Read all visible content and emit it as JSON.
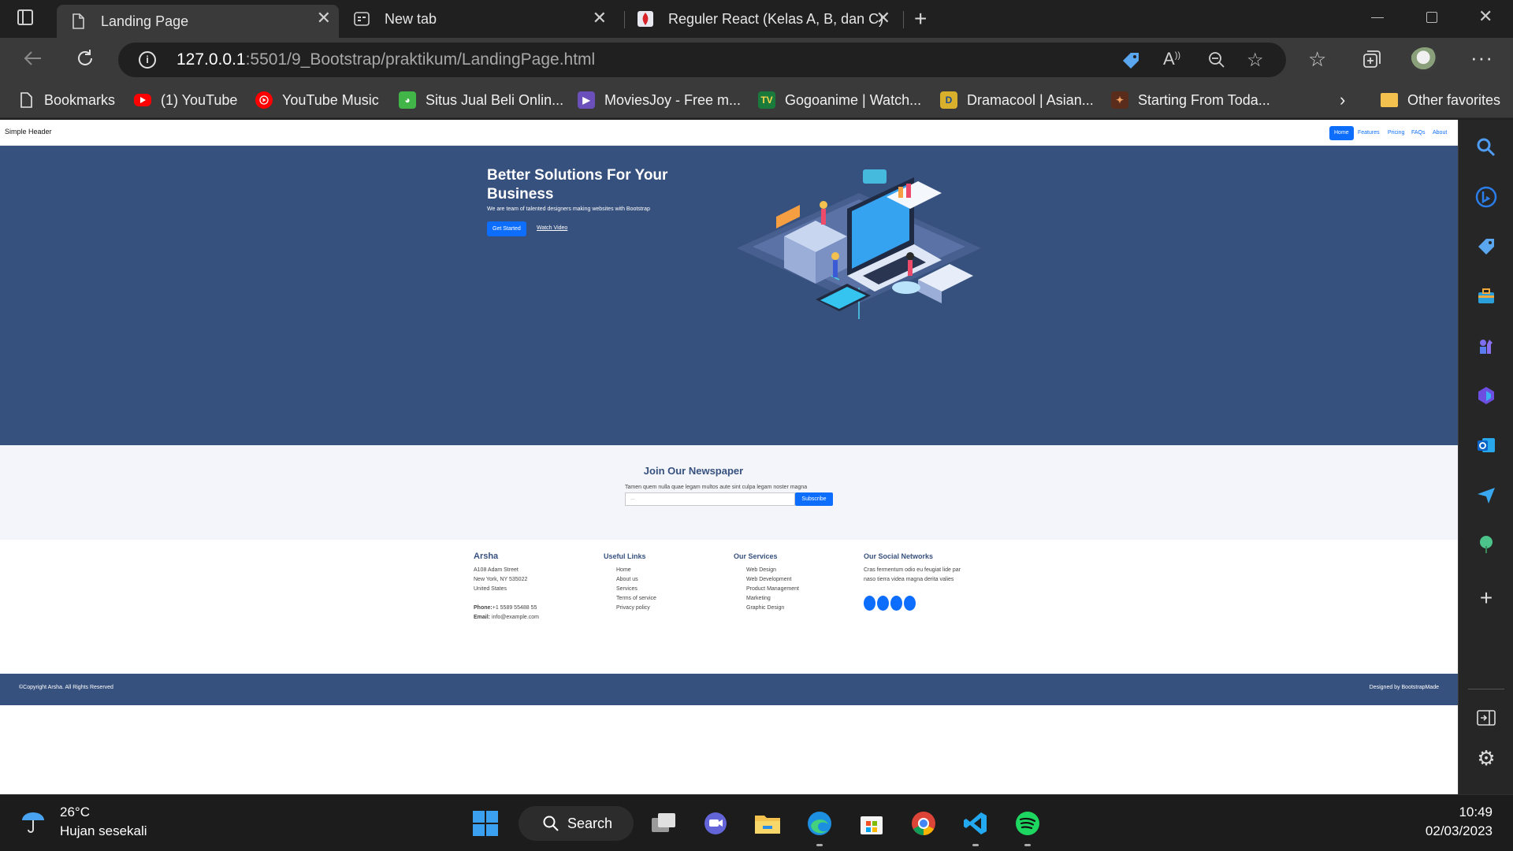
{
  "browser": {
    "tabs": [
      {
        "title": "Landing Page"
      },
      {
        "title": "New tab"
      },
      {
        "title": "Reguler React (Kelas A, B, dan C)"
      }
    ],
    "url_host": "127.0.0.1",
    "url_rest": ":5501/9_Bootstrap/praktikum/LandingPage.html",
    "favorites": [
      {
        "label": "Bookmarks",
        "icon": "page-icon"
      },
      {
        "label": "(1) YouTube",
        "icon": "youtube-icon"
      },
      {
        "label": "YouTube Music",
        "icon": "youtube-music-icon"
      },
      {
        "label": "Situs Jual Beli Onlin...",
        "icon": "tokopedia-icon"
      },
      {
        "label": "MoviesJoy - Free m...",
        "icon": "moviesjoy-icon"
      },
      {
        "label": "Gogoanime | Watch...",
        "icon": "gogoanime-icon"
      },
      {
        "label": "Dramacool | Asian...",
        "icon": "dramacool-icon"
      },
      {
        "label": "Starting From Toda...",
        "icon": "starting-icon"
      }
    ],
    "other_favorites": "Other favorites"
  },
  "page": {
    "brand": "Simple Header",
    "nav": [
      "Home",
      "Features",
      "Pricing",
      "FAQs",
      "About"
    ],
    "hero": {
      "title": "Better Solutions For Your Business",
      "subtitle": "We are team of talented designers making websites with Bootstrap",
      "primary": "Get Started",
      "secondary": "Watch Video"
    },
    "newsletter": {
      "title": "Join Our Newspaper",
      "desc": "Tamen quem nulla quae legam multos aute sint culpa legam noster magna",
      "placeholder": "...",
      "button": "Subscribe"
    },
    "footer": {
      "company": "Arsha",
      "address1": "A108 Adam Street",
      "address2": "New York, NY 535022",
      "address3": "United States",
      "phone_label": "Phone:",
      "phone": "+1 5589 55488 55",
      "email_label": "Email:",
      "email": "info@example.com",
      "useful_title": "Useful Links",
      "useful": [
        "Home",
        "About us",
        "Services",
        "Terms of service",
        "Privacy policy"
      ],
      "services_title": "Our Services",
      "services": [
        "Web Design",
        "Web Development",
        "Product Management",
        "Marketing",
        "Graphic Design"
      ],
      "social_title": "Our Social Networks",
      "social_desc1": "Cras fermentum odio eu feugiat lide par",
      "social_desc2": "naso tierra videa magna derita valies"
    },
    "copyright": "©Copyright Arsha. All Rights Reserved",
    "designed": "Designed by BootstrapMade"
  },
  "taskbar": {
    "temp": "26°C",
    "weather": "Hujan sesekali",
    "search": "Search",
    "time": "10:49",
    "date": "02/03/2023"
  },
  "colors": {
    "hero": "#37517e",
    "accent": "#0d6efd",
    "newsletter_bg": "#f3f5fa"
  }
}
